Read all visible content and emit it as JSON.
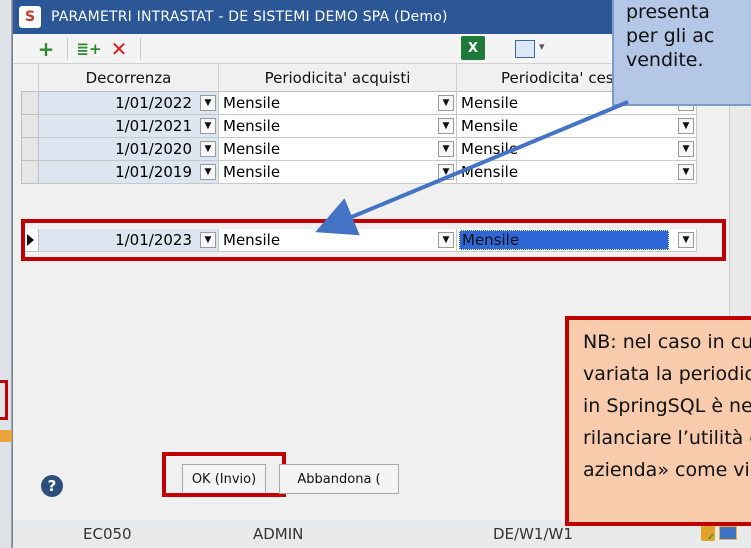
{
  "window": {
    "title": "PARAMETRI INTRASTAT - DE SISTEMI DEMO SPA  (Demo)",
    "minimize_glyph": "–",
    "app_icon_letter": "S"
  },
  "toolbar": {
    "add_icon": "plus-icon",
    "insert_icon": "insert-row-icon",
    "delete_icon": "delete-icon",
    "excel_label": "X",
    "grid_icon": "grid-settings-icon"
  },
  "grid": {
    "columns": [
      "Decorrenza",
      "Periodicita' acquisti",
      "Periodicita' ces"
    ],
    "rows": [
      {
        "date": "1/01/2022",
        "acquisti": "Mensile",
        "cessioni": "Mensile"
      },
      {
        "date": "1/01/2021",
        "acquisti": "Mensile",
        "cessioni": "Mensile"
      },
      {
        "date": "1/01/2020",
        "acquisti": "Mensile",
        "cessioni": "Mensile"
      },
      {
        "date": "1/01/2019",
        "acquisti": "Mensile",
        "cessioni": "Mensile"
      },
      {
        "date": "1/01/2023",
        "acquisti": "Mensile",
        "cessioni": "Mensile"
      }
    ]
  },
  "buttons": {
    "ok": "OK (Invio)",
    "abandon": "Abbandona ("
  },
  "status": {
    "company": "EC050",
    "user": "ADMIN",
    "path": "DE/W1/W1"
  },
  "callouts": {
    "top_lines": [
      "presenta",
      "per gli ac",
      "vendite. "
    ],
    "bottom_lines": [
      "NB: nel caso in cui sia sta",
      "variata la periodicità INTR",
      "in SpringSQL è necessario",
      "rilanciare l’utilità di «Avvi",
      "azienda» come visto a pa"
    ]
  },
  "colors": {
    "titlebar": "#2b5797",
    "highlight_red": "#c00000",
    "callout_blue": "#b4c7e7",
    "callout_orange": "#f8cbad",
    "selection_blue": "#2f67d6"
  }
}
